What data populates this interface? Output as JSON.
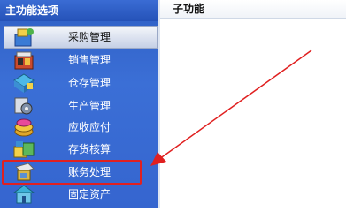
{
  "sidebar": {
    "title": "主功能选项",
    "items": [
      {
        "label": "采购管理",
        "icon": "purchase-icon",
        "selected": true
      },
      {
        "label": "销售管理",
        "icon": "sales-icon",
        "selected": false
      },
      {
        "label": "仓存管理",
        "icon": "warehouse-icon",
        "selected": false
      },
      {
        "label": "生产管理",
        "icon": "production-icon",
        "selected": false
      },
      {
        "label": "应收应付",
        "icon": "receivables-icon",
        "selected": false
      },
      {
        "label": "存货核算",
        "icon": "inventory-accounting-icon",
        "selected": false
      },
      {
        "label": "账务处理",
        "icon": "accounting-icon",
        "selected": false
      },
      {
        "label": "固定资产",
        "icon": "fixed-assets-icon",
        "selected": false
      }
    ]
  },
  "main": {
    "title": "子功能"
  },
  "colors": {
    "sidebar_bg": "#3565cf",
    "highlight": "#e02020",
    "arrow": "#e02020"
  }
}
